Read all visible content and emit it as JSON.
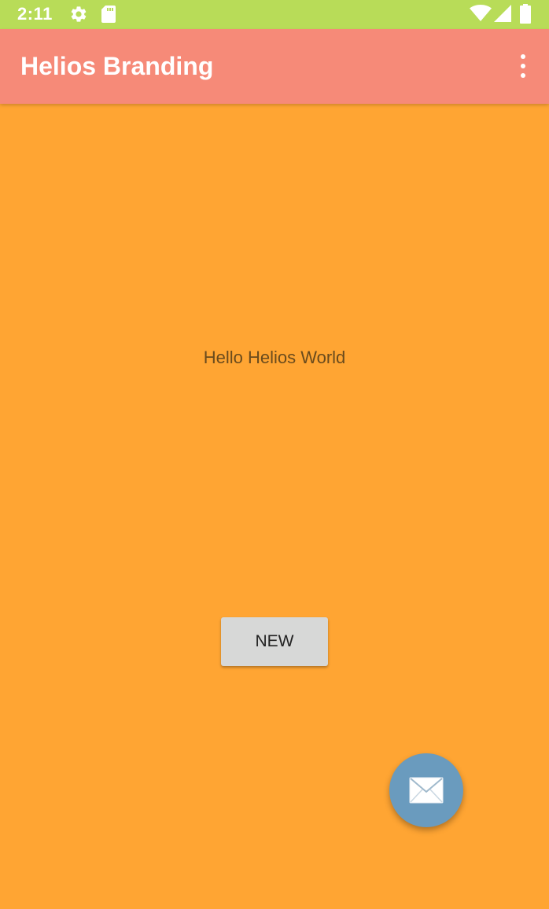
{
  "status_bar": {
    "time": "2:11",
    "icons": [
      "settings-icon",
      "sd-card-icon",
      "wifi-icon",
      "cell-signal-icon",
      "battery-icon"
    ]
  },
  "app_bar": {
    "title": "Helios Branding",
    "menu_icon": "more-vert-icon"
  },
  "content": {
    "hello_text": "Hello Helios World",
    "new_button_label": "NEW"
  },
  "fab": {
    "icon": "mail-icon"
  },
  "colors": {
    "status_bar": "#B8DC58",
    "app_bar": "#F68A78",
    "background": "#FFA533",
    "button": "#D7D8D7",
    "fab": "#6A9BBE"
  }
}
